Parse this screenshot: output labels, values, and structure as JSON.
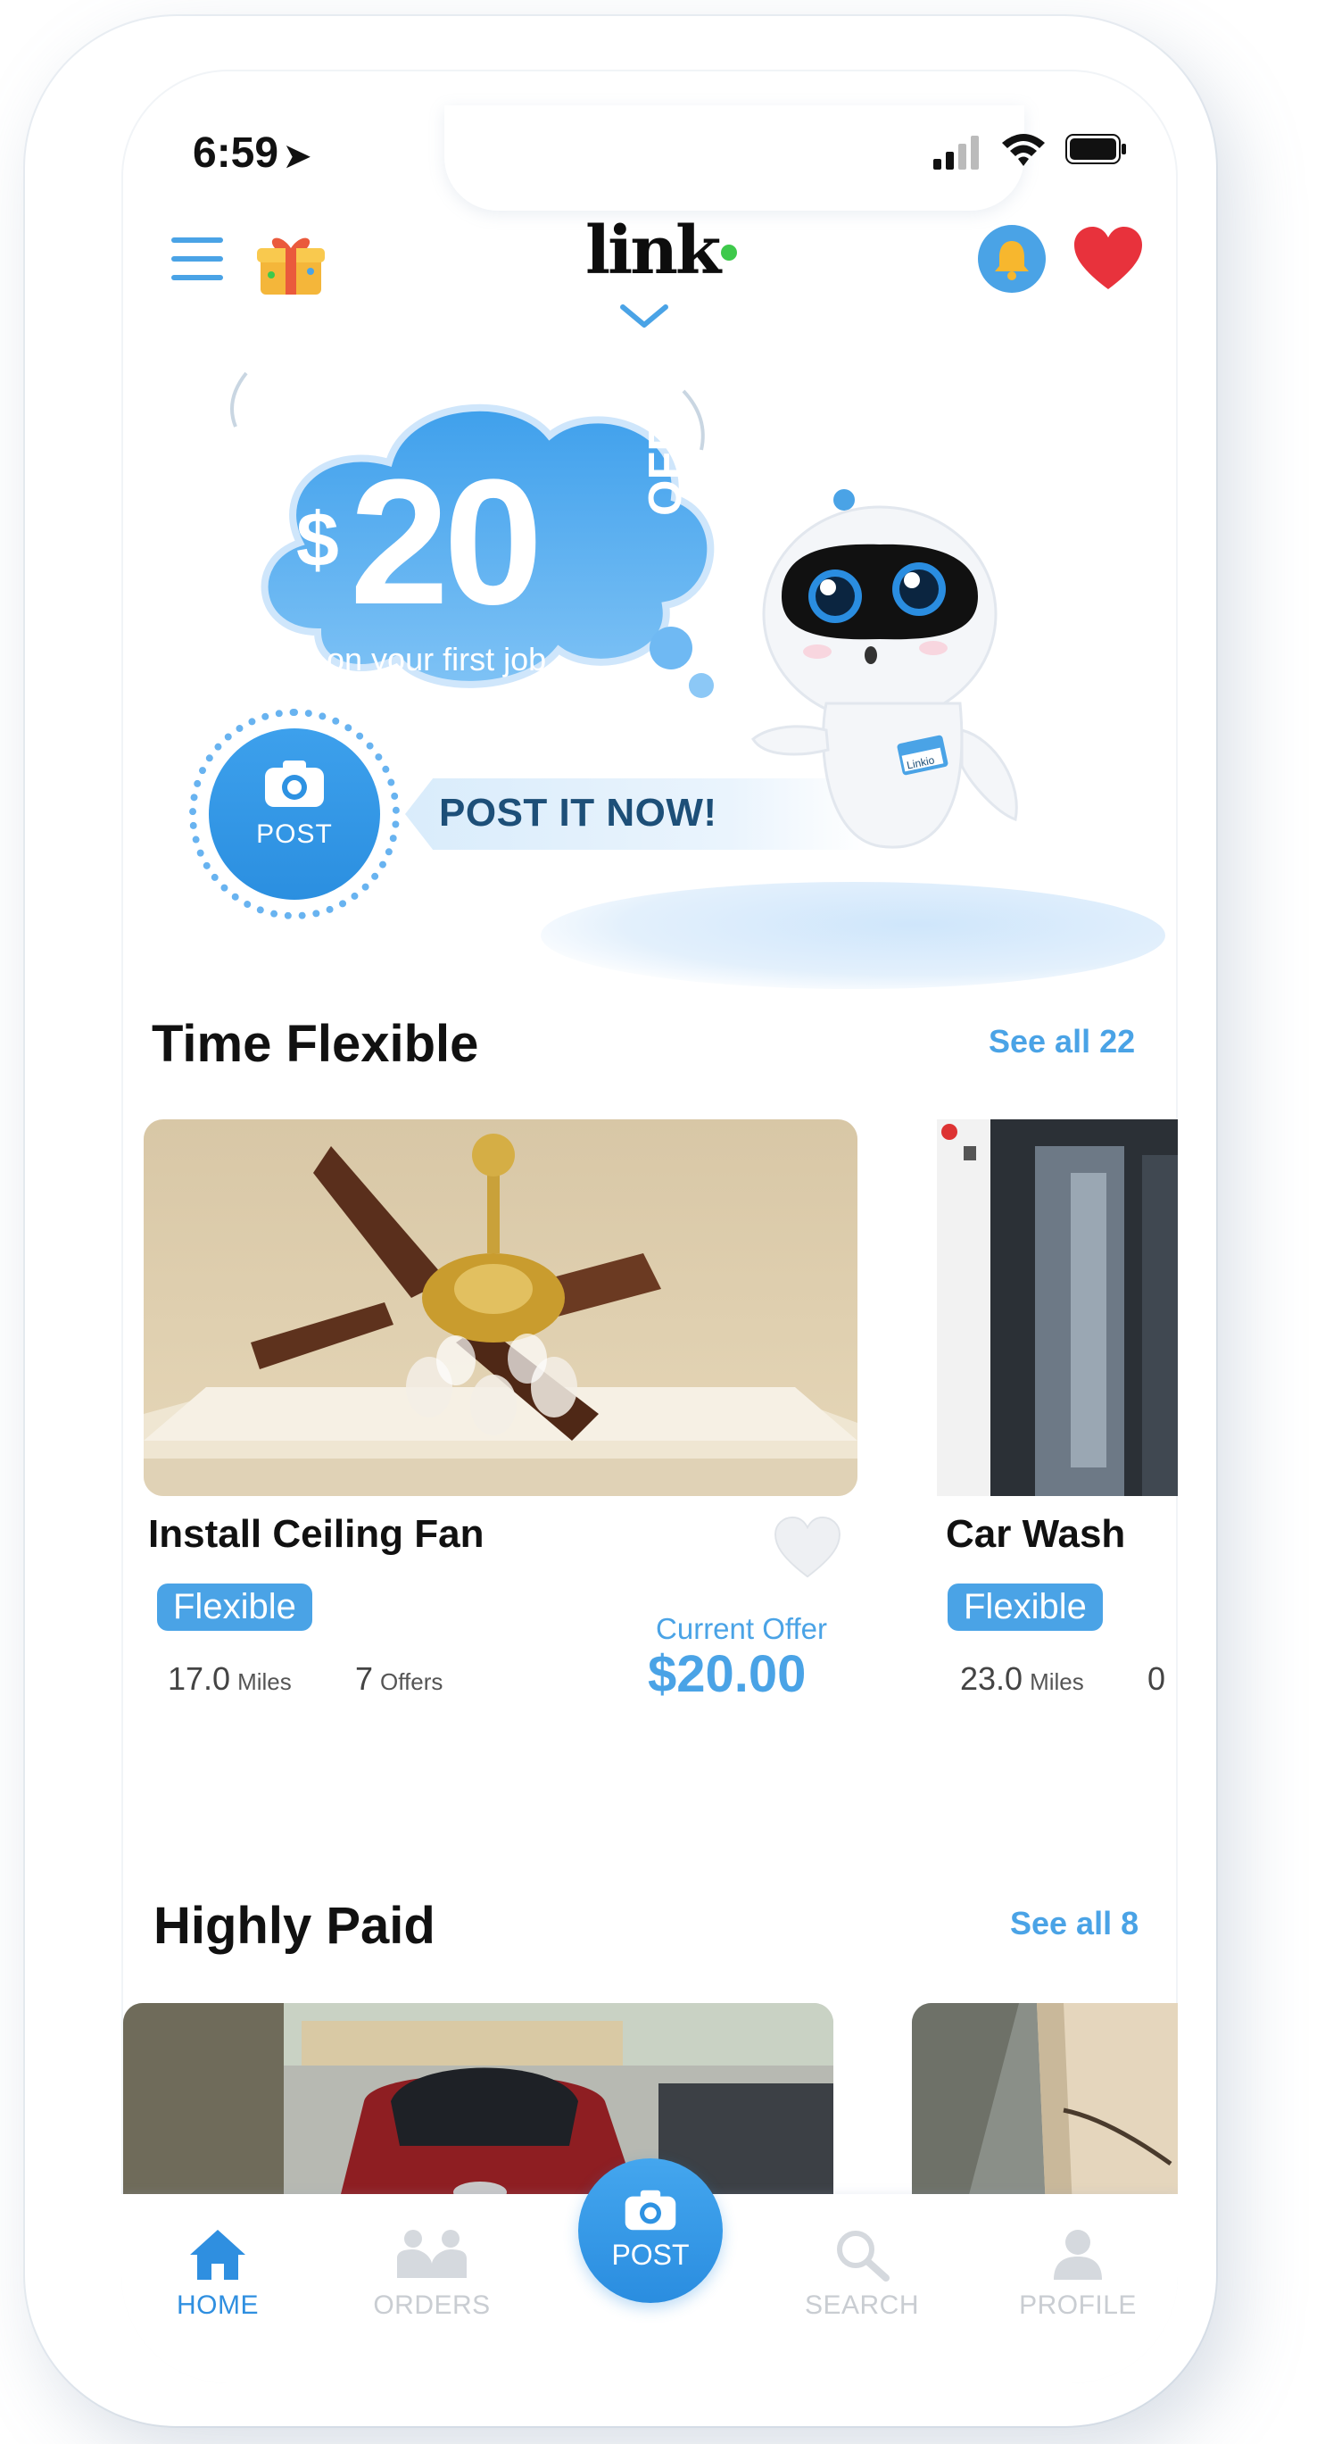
{
  "status_bar": {
    "time": "6:59",
    "location_arrow": "➤"
  },
  "header": {
    "menu_icon": "hamburger-icon",
    "gift_icon": "gift-icon",
    "logo_text": "link",
    "bell_icon": "bell-icon",
    "favorites_icon": "heart-icon"
  },
  "promo": {
    "dollar": "$",
    "amount": "20",
    "off": "OFF",
    "subtitle": "on your first job",
    "post_button_label": "POST",
    "cta": "POST IT NOW!",
    "robot_tag": "Linkio"
  },
  "sections": [
    {
      "title": "Time Flexible",
      "see_all": "See all 22",
      "cards": [
        {
          "title": "Install Ceiling Fan",
          "badge": "Flexible",
          "miles": "17.0",
          "miles_unit": "Miles",
          "offers": "7",
          "offers_unit": "Offers",
          "offer_label": "Current Offer",
          "offer_value": "$20.00"
        },
        {
          "title": "Car Wash",
          "badge": "Flexible",
          "miles": "23.0",
          "miles_unit": "Miles",
          "offers": "0"
        }
      ]
    },
    {
      "title": "Highly Paid",
      "see_all": "See all 8"
    }
  ],
  "tabbar": {
    "home": "HOME",
    "orders": "ORDERS",
    "post": "POST",
    "search": "SEARCH",
    "profile": "PROFILE"
  },
  "colors": {
    "accent": "#4aa3e6",
    "heart": "#e8323c",
    "online_dot": "#3ec94b"
  }
}
